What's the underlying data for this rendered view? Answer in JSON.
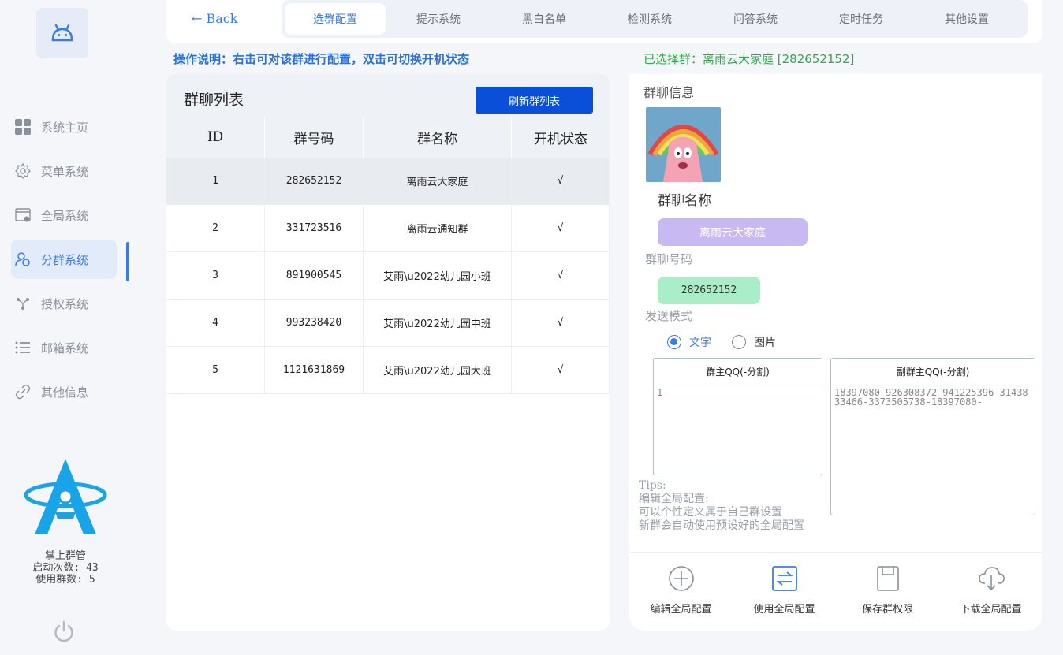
{
  "sidebar": {
    "items": [
      {
        "label": "系统主页",
        "icon": "grid-icon"
      },
      {
        "label": "菜单系统",
        "icon": "gear-icon"
      },
      {
        "label": "全局系统",
        "icon": "window-icon"
      },
      {
        "label": "分群系统",
        "icon": "users-icon"
      },
      {
        "label": "授权系统",
        "icon": "share-icon"
      },
      {
        "label": "邮箱系统",
        "icon": "list-icon"
      },
      {
        "label": "其他信息",
        "icon": "link-icon"
      }
    ],
    "active_index": 3,
    "app_name": "掌上群管",
    "launch_count": "启动次数: 43",
    "group_count": "使用群数: 5"
  },
  "topbar": {
    "back_label": "← Back",
    "tabs": [
      "选群配置",
      "提示系统",
      "黑白名单",
      "检测系统",
      "问答系统",
      "定时任务",
      "其他设置"
    ],
    "active_tab": 0
  },
  "instruction": "操作说明：右击可对该群进行配置，双击可切换开机状态",
  "selected_group": "已选择群：离雨云大家庭 [282652152]",
  "group_list": {
    "title": "群聊列表",
    "refresh_label": "刷新群列表",
    "columns": [
      "ID",
      "群号码",
      "群名称",
      "开机状态"
    ],
    "rows": [
      {
        "id": "1",
        "number": "282652152",
        "name": "离雨云大家庭",
        "status": "√"
      },
      {
        "id": "2",
        "number": "331723516",
        "name": "离雨云通知群",
        "status": "√"
      },
      {
        "id": "3",
        "number": "891900545",
        "name": "艾雨\\u2022幼儿园小班",
        "status": "√"
      },
      {
        "id": "4",
        "number": "993238420",
        "name": "艾雨\\u2022幼儿园中班",
        "status": "√"
      },
      {
        "id": "5",
        "number": "1121631869",
        "name": "艾雨\\u2022幼儿园大班",
        "status": "√"
      }
    ],
    "selected_row": 0
  },
  "group_info": {
    "section_label": "群聊信息",
    "name_label": "群聊名称",
    "name_value": "离雨云大家庭",
    "number_label": "群聊号码",
    "number_value": "282652152",
    "mode_label": "发送模式",
    "mode_options": [
      "文字",
      "图片"
    ],
    "mode_selected": 0,
    "owner_qq_header": "群主QQ(-分割)",
    "owner_qq_value": "1-",
    "admin_qq_header": "副群主QQ(-分割)",
    "admin_qq_value": "18397080-926308372-941225396-3143833466-3373505738-18397080-",
    "tips": [
      "Tips:",
      "编辑全局配置:",
      "可以个性定义属于自己群设置",
      "新群会自动使用预设好的全局配置"
    ],
    "actions": [
      {
        "label": "编辑全局配置",
        "icon": "plus-circle-icon"
      },
      {
        "label": "使用全局配置",
        "icon": "swap-icon"
      },
      {
        "label": "保存群权限",
        "icon": "save-icon"
      },
      {
        "label": "下载全局配置",
        "icon": "cloud-download-icon"
      }
    ]
  },
  "colors": {
    "accent": "#3b7be8",
    "refresh_button": "#0a4fd8",
    "selected_group_text": "#2faa4a",
    "name_pill": "#c8b9f3",
    "number_pill": "#a9eec8"
  }
}
